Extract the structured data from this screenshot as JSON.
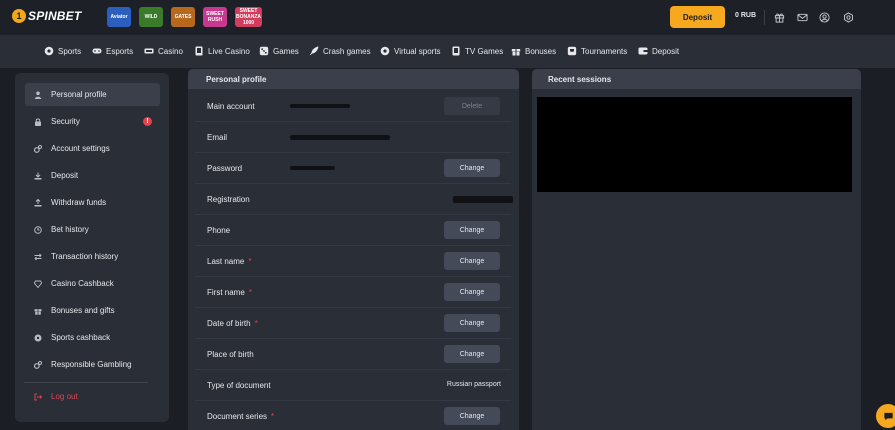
{
  "header": {
    "logo_mark": "1",
    "logo_text": "SPINBET",
    "promos": [
      {
        "name": "aviator-promo",
        "label": "Aviator",
        "color": "#2b5fbf"
      },
      {
        "name": "wild-promo",
        "label": "WILD",
        "color": "#3a7a2a"
      },
      {
        "name": "olympus-promo",
        "label": "GATES",
        "color": "#b8681c"
      },
      {
        "name": "sweet-rush-promo",
        "label": "SWEET RUSH",
        "color": "#c6398f"
      },
      {
        "name": "sweet-bonanza-promo",
        "label": "SWEET BONANZA 1000",
        "color": "#d23d5e"
      }
    ],
    "deposit_label": "Deposit",
    "balance": "0 RUB",
    "icons": [
      "gift-icon",
      "mail-icon",
      "user-icon",
      "settings-icon"
    ]
  },
  "nav": {
    "items": [
      {
        "label": "Sports",
        "icon": "ball-icon"
      },
      {
        "label": "Esports",
        "icon": "gamepad-icon"
      },
      {
        "label": "Casino",
        "icon": "cards-icon"
      },
      {
        "label": "Live Casino",
        "icon": "tv-icon"
      },
      {
        "label": "Games",
        "icon": "dice-icon"
      },
      {
        "label": "Crash games",
        "icon": "rocket-icon"
      },
      {
        "label": "Virtual sports",
        "icon": "ball-icon"
      },
      {
        "label": "TV Games",
        "icon": "tv-icon"
      },
      {
        "label": "Bonuses",
        "icon": "gift-icon"
      },
      {
        "label": "Tournaments",
        "icon": "cup-icon"
      },
      {
        "label": "Deposit",
        "icon": "wallet-icon"
      }
    ]
  },
  "sidebar": {
    "items": [
      {
        "label": "Personal profile",
        "icon": "user-icon"
      },
      {
        "label": "Security",
        "icon": "lock-icon",
        "badge": "!"
      },
      {
        "label": "Account settings",
        "icon": "gears-icon"
      },
      {
        "label": "Deposit",
        "icon": "download-icon"
      },
      {
        "label": "Withdraw funds",
        "icon": "upload-icon"
      },
      {
        "label": "Bet history",
        "icon": "clock-icon"
      },
      {
        "label": "Transaction history",
        "icon": "arrows-icon"
      },
      {
        "label": "Casino Cashback",
        "icon": "diamond-icon"
      },
      {
        "label": "Bonuses and gifts",
        "icon": "gift-icon"
      },
      {
        "label": "Sports cashback",
        "icon": "ball-icon"
      },
      {
        "label": "Responsible Gambling",
        "icon": "gears-icon"
      }
    ],
    "logout": {
      "label": "Log out",
      "icon": "logout-icon"
    }
  },
  "profile": {
    "title": "Personal profile",
    "rows": [
      {
        "label": "Main account",
        "required": false,
        "button": "Delete",
        "disabled": true,
        "value": ""
      },
      {
        "label": "Email",
        "required": false,
        "button": "",
        "value": ""
      },
      {
        "label": "Password",
        "required": false,
        "button": "Change",
        "value": ""
      },
      {
        "label": "Registration",
        "required": false,
        "button": "",
        "value": ""
      },
      {
        "label": "Phone",
        "required": false,
        "button": "Change",
        "value": ""
      },
      {
        "label": "Last name",
        "required": true,
        "button": "Change",
        "value": ""
      },
      {
        "label": "First name",
        "required": true,
        "button": "Change",
        "value": ""
      },
      {
        "label": "Date of birth",
        "required": true,
        "button": "Change",
        "value": ""
      },
      {
        "label": "Place of birth",
        "required": false,
        "button": "Change",
        "value": ""
      },
      {
        "label": "Type of document",
        "required": false,
        "button": "",
        "value": "Russian passport"
      },
      {
        "label": "Document series",
        "required": true,
        "button": "Change",
        "value": ""
      }
    ],
    "required_mark": "*"
  },
  "sessions": {
    "title": "Recent sessions"
  },
  "colors": {
    "accent": "#f6a81f",
    "danger": "#e0444f",
    "panel": "#2a2e36",
    "background": "#1b1e24"
  }
}
